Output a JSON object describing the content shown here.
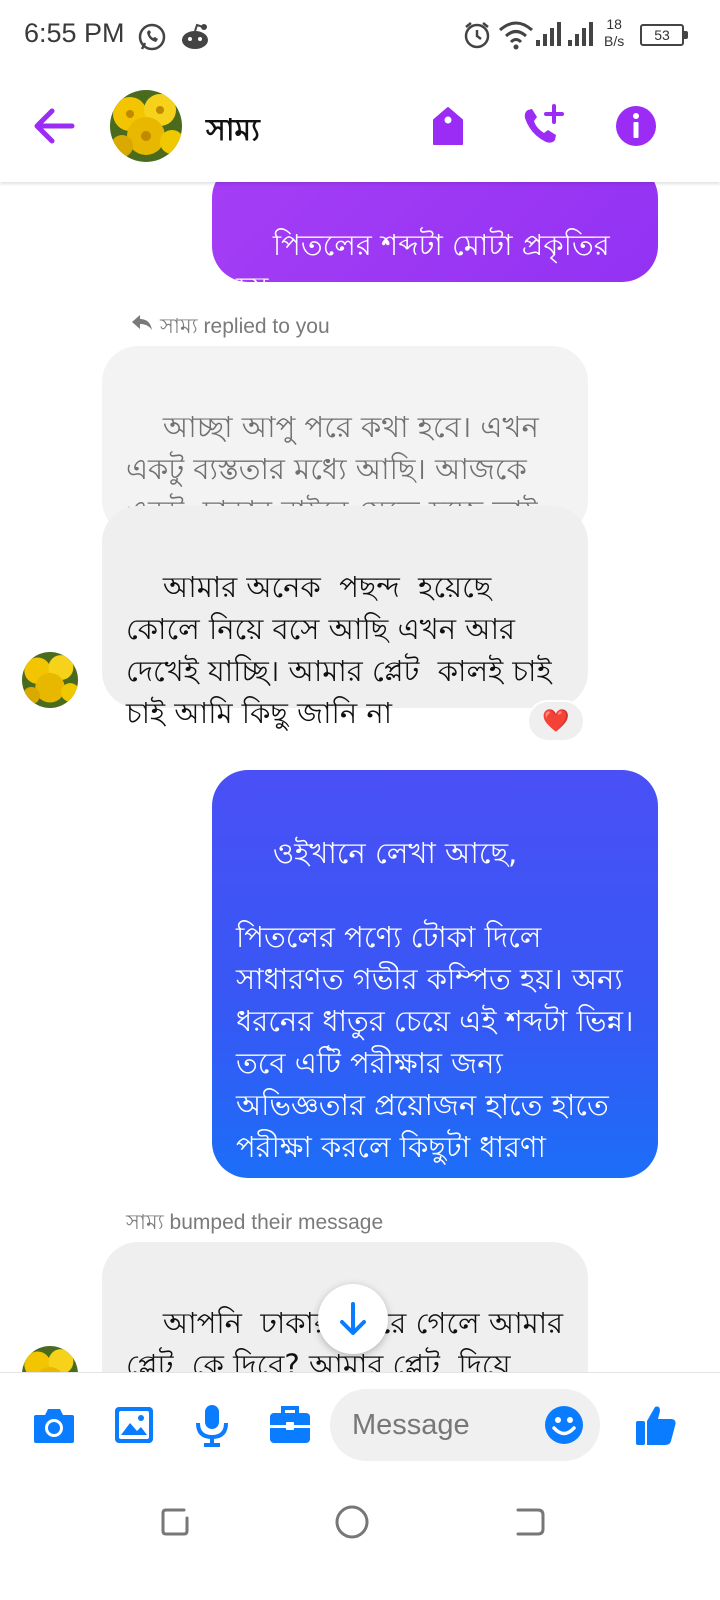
{
  "status_bar": {
    "time": "6:55 PM",
    "net_speed_value": "18",
    "net_speed_unit": "B/s",
    "battery": "53"
  },
  "header": {
    "contact_name": "সাম্য",
    "accent_color": "#9b2cf5"
  },
  "messages": {
    "out_partial": "পিতলের শব্দটা মোটা প্রকৃতির হয়",
    "reply_note": "সাম্য replied to you",
    "in_reply_quote": "আচ্ছা আপু পরে কথা হবে। এখন একটু ব্যস্ততার মধ্যে আছি। আজকে একটু  ঢাকার বাইরে যেতে হচ্ছে তাই",
    "in_reply": "আমার অনেক  পছন্দ  হয়েছে কোলে নিয়ে বসে আছি এখন আর দেখেই যাচ্ছি। আমার প্লেট  কালই চাই চাই আমি কিছু জানি না",
    "reaction": "❤️",
    "out_long": "ওইখানে লেখা আছে,\n\nপিতলের পণ্যে টোকা দিলে সাধারণত গভীর কম্পিত হয়। অন্য ধরনের ধাতুর চেয়ে এই শব্দটা ভিন্ন। তবে এটি পরীক্ষার জন্য অভিজ্ঞতার প্রয়োজন হাতে হাতে পরীক্ষা করলে কিছুটা ধারণা   পাওয়া যেতে পারে।",
    "bump_note": "সাম্য bumped their message",
    "in_bumped": "আপনি  ঢাকার বাইরে গেলে আমার প্লেট  কে দিবে? আমার প্লেট  দিয়ে পরে যান"
  },
  "composer": {
    "placeholder": "Message",
    "icon_color": "#0a7cff"
  },
  "icons": [
    "back-arrow-icon",
    "tag-icon",
    "add-call-icon",
    "info-icon",
    "camera-icon",
    "gallery-icon",
    "microphone-icon",
    "toolbox-icon",
    "emoji-icon",
    "thumbs-up-icon",
    "arrow-down-icon"
  ]
}
